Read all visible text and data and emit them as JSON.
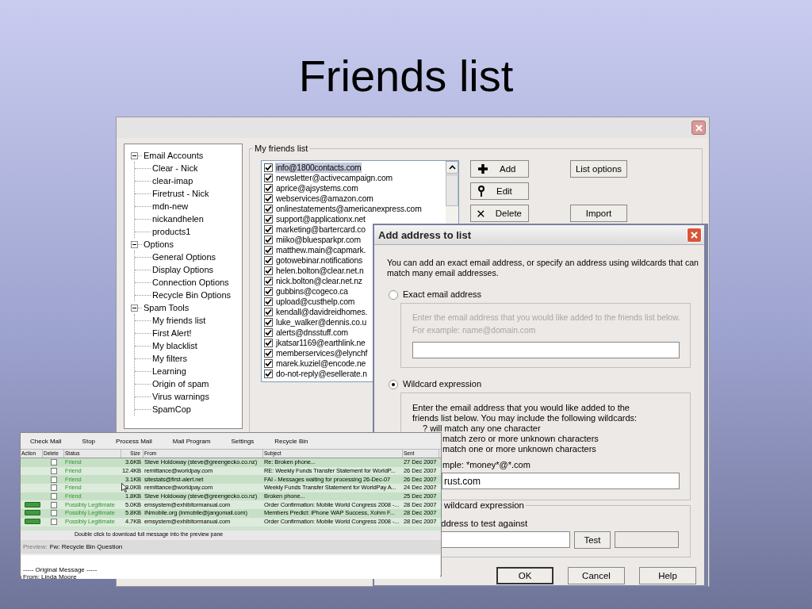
{
  "slide_title": "Friends list",
  "main_window": {
    "tree": [
      {
        "label": "Email Accounts",
        "expanded": true,
        "children": [
          {
            "label": "Clear - Nick"
          },
          {
            "label": "clear-imap"
          },
          {
            "label": "Firetrust - Nick"
          },
          {
            "label": "mdn-new"
          },
          {
            "label": "nickandhelen"
          },
          {
            "label": "products1"
          }
        ]
      },
      {
        "label": "Options",
        "expanded": true,
        "children": [
          {
            "label": "General Options"
          },
          {
            "label": "Display Options"
          },
          {
            "label": "Connection Options"
          },
          {
            "label": "Recycle Bin Options"
          }
        ]
      },
      {
        "label": "Spam Tools",
        "expanded": true,
        "children": [
          {
            "label": "My friends list"
          },
          {
            "label": "First Alert!"
          },
          {
            "label": "My blacklist"
          },
          {
            "label": "My filters"
          },
          {
            "label": "Learning"
          },
          {
            "label": "Origin of spam"
          },
          {
            "label": "Virus warnings"
          },
          {
            "label": "SpamCop"
          }
        ]
      }
    ],
    "friends_list": {
      "legend": "My friends list",
      "items": [
        {
          "address": "info@1800contacts.com",
          "checked": true,
          "selected": true
        },
        {
          "address": "newsletter@activecampaign.com",
          "checked": true,
          "selected": false
        },
        {
          "address": "aprice@ajsystems.com",
          "checked": true,
          "selected": false
        },
        {
          "address": "webservices@amazon.com",
          "checked": true,
          "selected": false
        },
        {
          "address": "onlinestatements@americanexpress.com",
          "checked": true,
          "selected": false
        },
        {
          "address": "support@applicationx.net",
          "checked": true,
          "selected": false
        },
        {
          "address": "marketing@bartercard.co",
          "checked": true,
          "selected": false
        },
        {
          "address": "miiko@bluesparkpr.com",
          "checked": true,
          "selected": false
        },
        {
          "address": "matthew.main@capmark.",
          "checked": true,
          "selected": false
        },
        {
          "address": "gotowebinar.notifications",
          "checked": true,
          "selected": false
        },
        {
          "address": "helen.bolton@clear.net.n",
          "checked": true,
          "selected": false
        },
        {
          "address": "nick.bolton@clear.net.nz",
          "checked": true,
          "selected": false
        },
        {
          "address": "gubbins@cogeco.ca",
          "checked": true,
          "selected": false
        },
        {
          "address": "upload@custhelp.com",
          "checked": true,
          "selected": false
        },
        {
          "address": "kendall@davidreidhomes.",
          "checked": true,
          "selected": false
        },
        {
          "address": "luke_walker@dennis.co.u",
          "checked": true,
          "selected": false
        },
        {
          "address": "alerts@dnsstuff.com",
          "checked": true,
          "selected": false
        },
        {
          "address": "jkatsar1169@earthlink.ne",
          "checked": true,
          "selected": false
        },
        {
          "address": "memberservices@elynchf",
          "checked": true,
          "selected": false
        },
        {
          "address": "marek.kuziel@encode.ne",
          "checked": true,
          "selected": false
        },
        {
          "address": "do-not-reply@esellerate.n",
          "checked": true,
          "selected": false
        }
      ]
    },
    "buttons": [
      {
        "label": "Add",
        "kind": "add"
      },
      {
        "label": "Edit",
        "kind": "edit"
      },
      {
        "label": "Delete",
        "kind": "delete"
      }
    ],
    "side_buttons": [
      "List options",
      "Import"
    ]
  },
  "add_dialog": {
    "title": "Add address to list",
    "intro": "You can add an exact email address, or specify an address using wildcards that can match many email addresses.",
    "options": [
      {
        "label": "Exact email address",
        "selected": false
      },
      {
        "label": "Wildcard expression",
        "selected": true
      }
    ],
    "exact_group": {
      "disabled": true,
      "lines": [
        "Enter the email address that you would like added to the friends list below.",
        "For example: name@domain.com"
      ]
    },
    "wildcard_group": {
      "lines": [
        {
          "text": "Enter the email address that you would like added to the",
          "kind": "plain"
        },
        {
          "text": "friends list below. You may include the following wildcards:",
          "kind": "plain"
        },
        {
          "text": "? will match any one character",
          "kind": "indented"
        },
        {
          "text": "match zero or more unknown characters",
          "kind": "partial"
        },
        {
          "text": "match one or more unknown characters",
          "kind": "partial"
        },
        {
          "text": "mple: *money*@*.com",
          "kind": "partial"
        }
      ],
      "value": "rust.com"
    },
    "test_group": {
      "legend": "wildcard expression",
      "label": "ddress to test against",
      "button": "Test"
    },
    "buttons": [
      "OK",
      "Cancel",
      "Help"
    ]
  },
  "mail_window": {
    "toolbar": [
      "Check Mail",
      "Stop",
      "Process Mail",
      "Mail Program",
      "Settings",
      "Recycle Bin"
    ],
    "columns": [
      "Action",
      "Delete",
      "Status",
      "Size",
      "From",
      "Subject",
      "Sent"
    ],
    "rows": [
      {
        "action_button": false,
        "checked": false,
        "status": "Friend",
        "size": "3.6KB",
        "from": "Steve Holdoway (steve@greengecko.co.nz)",
        "subject": "Re: Broken phone...",
        "sent": "27 Dec 2007"
      },
      {
        "action_button": false,
        "checked": false,
        "status": "Friend",
        "size": "12.4KB",
        "from": "remittance@worldpay.com",
        "subject": "RE: Weekly Funds Transfer Statement for WorldP...",
        "sent": "26 Dec 2007"
      },
      {
        "action_button": false,
        "checked": false,
        "status": "Friend",
        "size": "3.1KB",
        "from": "sitestats@first-alert.net",
        "subject": "FAI - Messages waiting for processing 26-Dec-07",
        "sent": "26 Dec 2007"
      },
      {
        "action_button": false,
        "checked": false,
        "status": "Friend",
        "size": "3.0KB",
        "from": "remittance@worldpay.com",
        "subject": "Weekly Funds Transfer Statement for WorldPay A...",
        "sent": "24 Dec 2007"
      },
      {
        "action_button": false,
        "checked": false,
        "status": "Friend",
        "size": "1.8KB",
        "from": "Steve Holdoway (steve@greengecko.co.nz)",
        "subject": "Broken phone...",
        "sent": "25 Dec 2007"
      },
      {
        "action_button": true,
        "checked": false,
        "status": "Possibly Legitimate",
        "size": "5.0KB",
        "from": "emsystem@exhibitormanual.com",
        "subject": "Order Confirmation: Mobile World Congress 2008 -...",
        "sent": "28 Dec 2007"
      },
      {
        "action_button": true,
        "checked": false,
        "status": "Possibly Legitimate",
        "size": "5.8KB",
        "from": "INmobile.org (inmobile@jangomail.com)",
        "subject": "Members Predict: iPhone WAP Success, Xohm F...",
        "sent": "28 Dec 2007"
      },
      {
        "action_button": true,
        "checked": false,
        "status": "Possibly Legitimate",
        "size": "4.7KB",
        "from": "emsystem@exhibitormanual.com",
        "subject": "Order Confirmation: Mobile World Congress 2008 -...",
        "sent": "28 Dec 2007"
      }
    ],
    "hint": "Double click to download full message into the preview pane",
    "preview": {
      "label": "Preview:",
      "subject": "Fw: Recycle Bin Question",
      "body": [
        "----- Original Message -----",
        "From: Linda Moore"
      ]
    }
  }
}
